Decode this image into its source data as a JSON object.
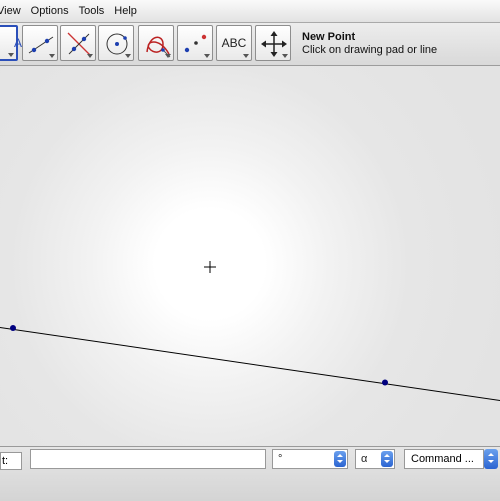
{
  "menubar": {
    "items": [
      "View",
      "Options",
      "Tools",
      "Help"
    ],
    "first_visible": "View"
  },
  "toolbar": {
    "tools": [
      {
        "name": "move-tool",
        "label": "A",
        "selected": true,
        "icon": "arrow-cursor-icon"
      },
      {
        "name": "point-tool",
        "icon": "new-point-icon"
      },
      {
        "name": "line-tool",
        "icon": "line-through-two-points-icon"
      },
      {
        "name": "perpendicular-tool",
        "icon": "perpendicular-line-icon"
      },
      {
        "name": "circle-tool",
        "icon": "circle-with-center-icon"
      },
      {
        "name": "locus-tool",
        "icon": "locus-icon"
      },
      {
        "name": "reflect-tool",
        "icon": "reflect-point-icon"
      },
      {
        "name": "text-tool",
        "label": "ABC",
        "icon": "insert-text-icon"
      },
      {
        "name": "move-view-tool",
        "icon": "move-graphics-view-icon"
      }
    ],
    "info": {
      "name": "New Point",
      "hint": "Click on drawing pad or line"
    }
  },
  "canvas": {
    "accent": "#00007f",
    "line_color": "#000000"
  },
  "inputbar": {
    "label": "t:",
    "input_value": "",
    "degree_combo": "°",
    "alpha_combo": "α",
    "command_label": "Command ..."
  }
}
